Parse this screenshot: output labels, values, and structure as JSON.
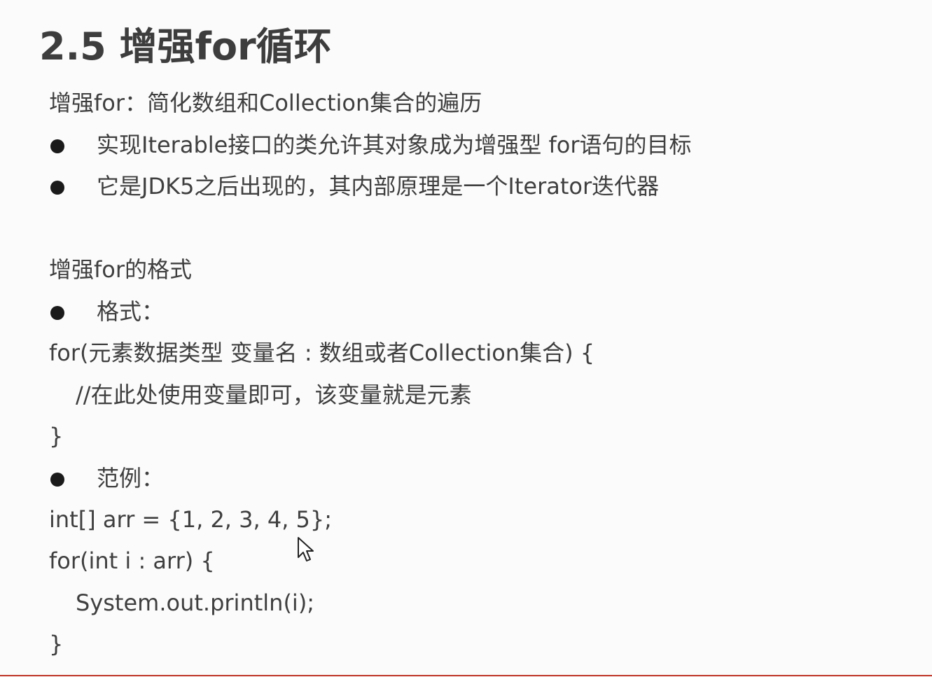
{
  "slide": {
    "title": "2.5 增强for循环",
    "intro": "增强for：简化数组和Collection集合的遍历",
    "intro_bullets": [
      "实现Iterable接口的类允许其对象成为增强型 for语句的目标",
      "它是JDK5之后出现的，其内部原理是一个Iterator迭代器"
    ],
    "format_heading": "增强for的格式",
    "format_bullet": "格式：",
    "format_code": {
      "line1": "for(元素数据类型 变量名 : 数组或者Collection集合) {",
      "line2": "//在此处使用变量即可，该变量就是元素",
      "line3": "}"
    },
    "example_bullet": "范例：",
    "example_code": {
      "line1": "int[] arr = {1, 2, 3, 4, 5};",
      "line2": "for(int i : arr) {",
      "line3": "System.out.println(i);",
      "line4": "}"
    }
  },
  "colors": {
    "text": "#3f3f3f",
    "bullet": "#1a1a1a",
    "bottom_rule": "#c0392b"
  },
  "icons": {
    "pointer": "mouse-cursor-icon"
  }
}
